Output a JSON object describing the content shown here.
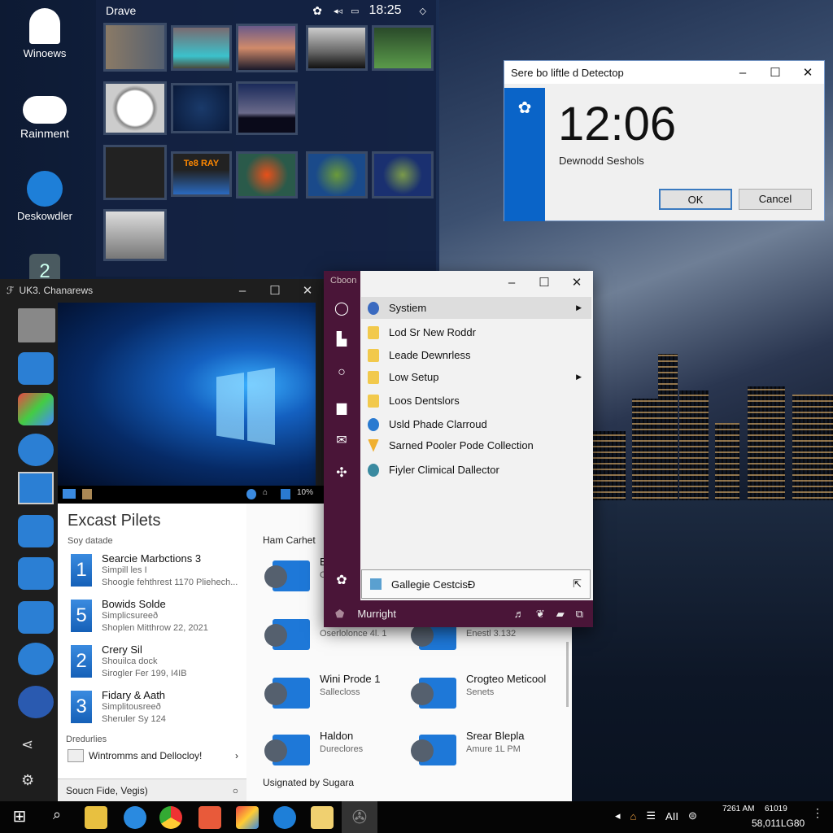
{
  "desktop": {
    "icons": [
      {
        "label": "Winoews",
        "icon": "user-icon"
      },
      {
        "label": "Rainment",
        "icon": "cloud-icon"
      },
      {
        "label": "Deskowdler",
        "icon": "pen-icon"
      },
      {
        "label": "2",
        "icon": "app-icon"
      }
    ]
  },
  "gallery": {
    "title": "Drave",
    "clock": "18:25",
    "status_icons": [
      "settings-icon",
      "volume-icon",
      "battery-icon",
      "diamond-icon"
    ],
    "thumb_label": "Te8 RAY"
  },
  "dialog": {
    "title": "Sere bo liftle d Detectop",
    "time": "12:06",
    "subtitle": "Dewnodd Seshols",
    "ok": "OK",
    "cancel": "Cancel",
    "accent": "#0a64c8"
  },
  "left_window": {
    "title": "UK3. Chanarews",
    "mini_taskbar_status": "10%",
    "panel_title": "Excast Pilets",
    "section1": "Soy datade",
    "items": [
      {
        "num": "1",
        "title": "Searcie Marbctions 3",
        "sub1": "Simpill les I",
        "sub2": "Shoogle fehthrest 1170 Pliehech..."
      },
      {
        "num": "5",
        "title": "Bowids Solde",
        "sub1": "Simplicsureeð",
        "sub2": "Shoplen Mitthrow 22, 2021"
      },
      {
        "num": "2",
        "title": "Crery Sil",
        "sub1": "Shouilca dock",
        "sub2": "Sirogler Fer 199, I4IB"
      },
      {
        "num": "3",
        "title": "Fidary & Aath",
        "sub1": "Simplitousreeð",
        "sub2": "Sheruler Sy 124"
      }
    ],
    "section2": "Dredurlies",
    "recent": "Wintromms and Dellocloy!",
    "search": "Soucn Fide, Vegis)",
    "right_heading": "Ham Carhet",
    "folders": [
      {
        "title": "E",
        "sub": "O"
      },
      {
        "title": "",
        "sub": "Oserlolonce 4l. 1"
      },
      {
        "title": "",
        "sub": "Enestl 3.132"
      },
      {
        "title": "Wini Prode 1",
        "sub": "Sallecloss"
      },
      {
        "title": "Crogteo Meticool",
        "sub": "Senets"
      },
      {
        "title": "Haldon",
        "sub": "Dureclores"
      },
      {
        "title": "Srear Blepla",
        "sub": "Amure 1L PM"
      }
    ],
    "footer": "Usignated by Sugara"
  },
  "menu_window": {
    "title": "Cboon",
    "items": [
      {
        "label": "Systiem",
        "submenu": true
      },
      {
        "label": "Lod Sr New Roddr"
      },
      {
        "label": "Leade Dewnrless"
      },
      {
        "label": "Low Setup",
        "submenu": true
      },
      {
        "label": "Loos Dentslors"
      },
      {
        "label": "Usld Phade Clarroud"
      },
      {
        "label": "Sarned Pooler Pode Collection"
      },
      {
        "label": "Fiyler Climical Dallector"
      }
    ],
    "search_value": "Gallegie CestcisÐ",
    "user": "Murright",
    "accent": "#4a1538"
  },
  "taskbar": {
    "apps": [
      "start-icon",
      "search-icon",
      "file-explorer-icon",
      "skype-icon",
      "chrome-icon",
      "photos-icon",
      "office-icon",
      "edge-icon",
      "folder-icon",
      "settings-icon"
    ],
    "tray_text": "AII",
    "time": "7261 AM",
    "date_top": "61019",
    "date": "58,011LG80"
  }
}
